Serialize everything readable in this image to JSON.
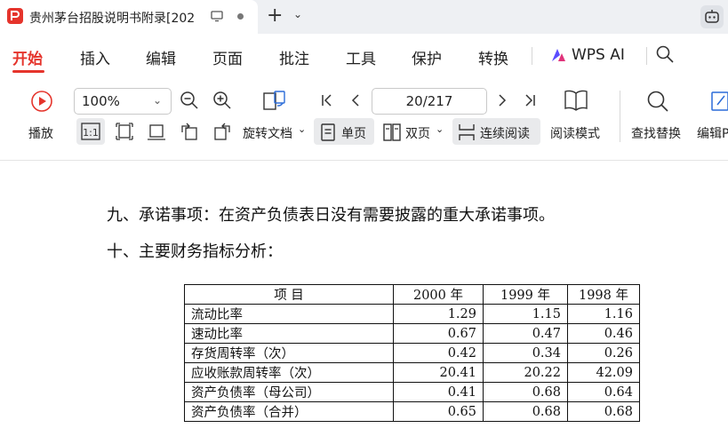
{
  "tab": {
    "title": "贵州茅台招股说明书附录[202"
  },
  "menu": {
    "items": [
      "开始",
      "插入",
      "编辑",
      "页面",
      "批注",
      "工具",
      "保护",
      "转换"
    ],
    "ai": "WPS AI"
  },
  "toolbar": {
    "play": "播放",
    "zoom": "100%",
    "rotate_doc": "旋转文档",
    "single_page": "单页",
    "double_page": "双页",
    "continuous": "连续阅读",
    "read_mode": "阅读模式",
    "find_replace": "查找替换",
    "edit": "编辑P",
    "page": "20/217"
  },
  "document": {
    "para9": "九、承诺事项：在资产负债表日没有需要披露的重大承诺事项。",
    "para10": "十、主要财务指标分析：",
    "table": {
      "headers": [
        "项      目",
        "2000 年",
        "1999 年",
        "1998 年"
      ],
      "rows": [
        [
          "流动比率",
          "1.29",
          "1.15",
          "1.16"
        ],
        [
          "速动比率",
          "0.67",
          "0.47",
          "0.46"
        ],
        [
          "存货周转率（次）",
          "0.42",
          "0.34",
          "0.26"
        ],
        [
          "应收账款周转率（次）",
          "20.41",
          "20.22",
          "42.09"
        ],
        [
          "资产负债率（母公司）",
          "0.41",
          "0.68",
          "0.64"
        ],
        [
          "资产负债率（合并）",
          "0.65",
          "0.68",
          "0.68"
        ]
      ]
    }
  },
  "colors": {
    "accent": "#e5342c"
  }
}
